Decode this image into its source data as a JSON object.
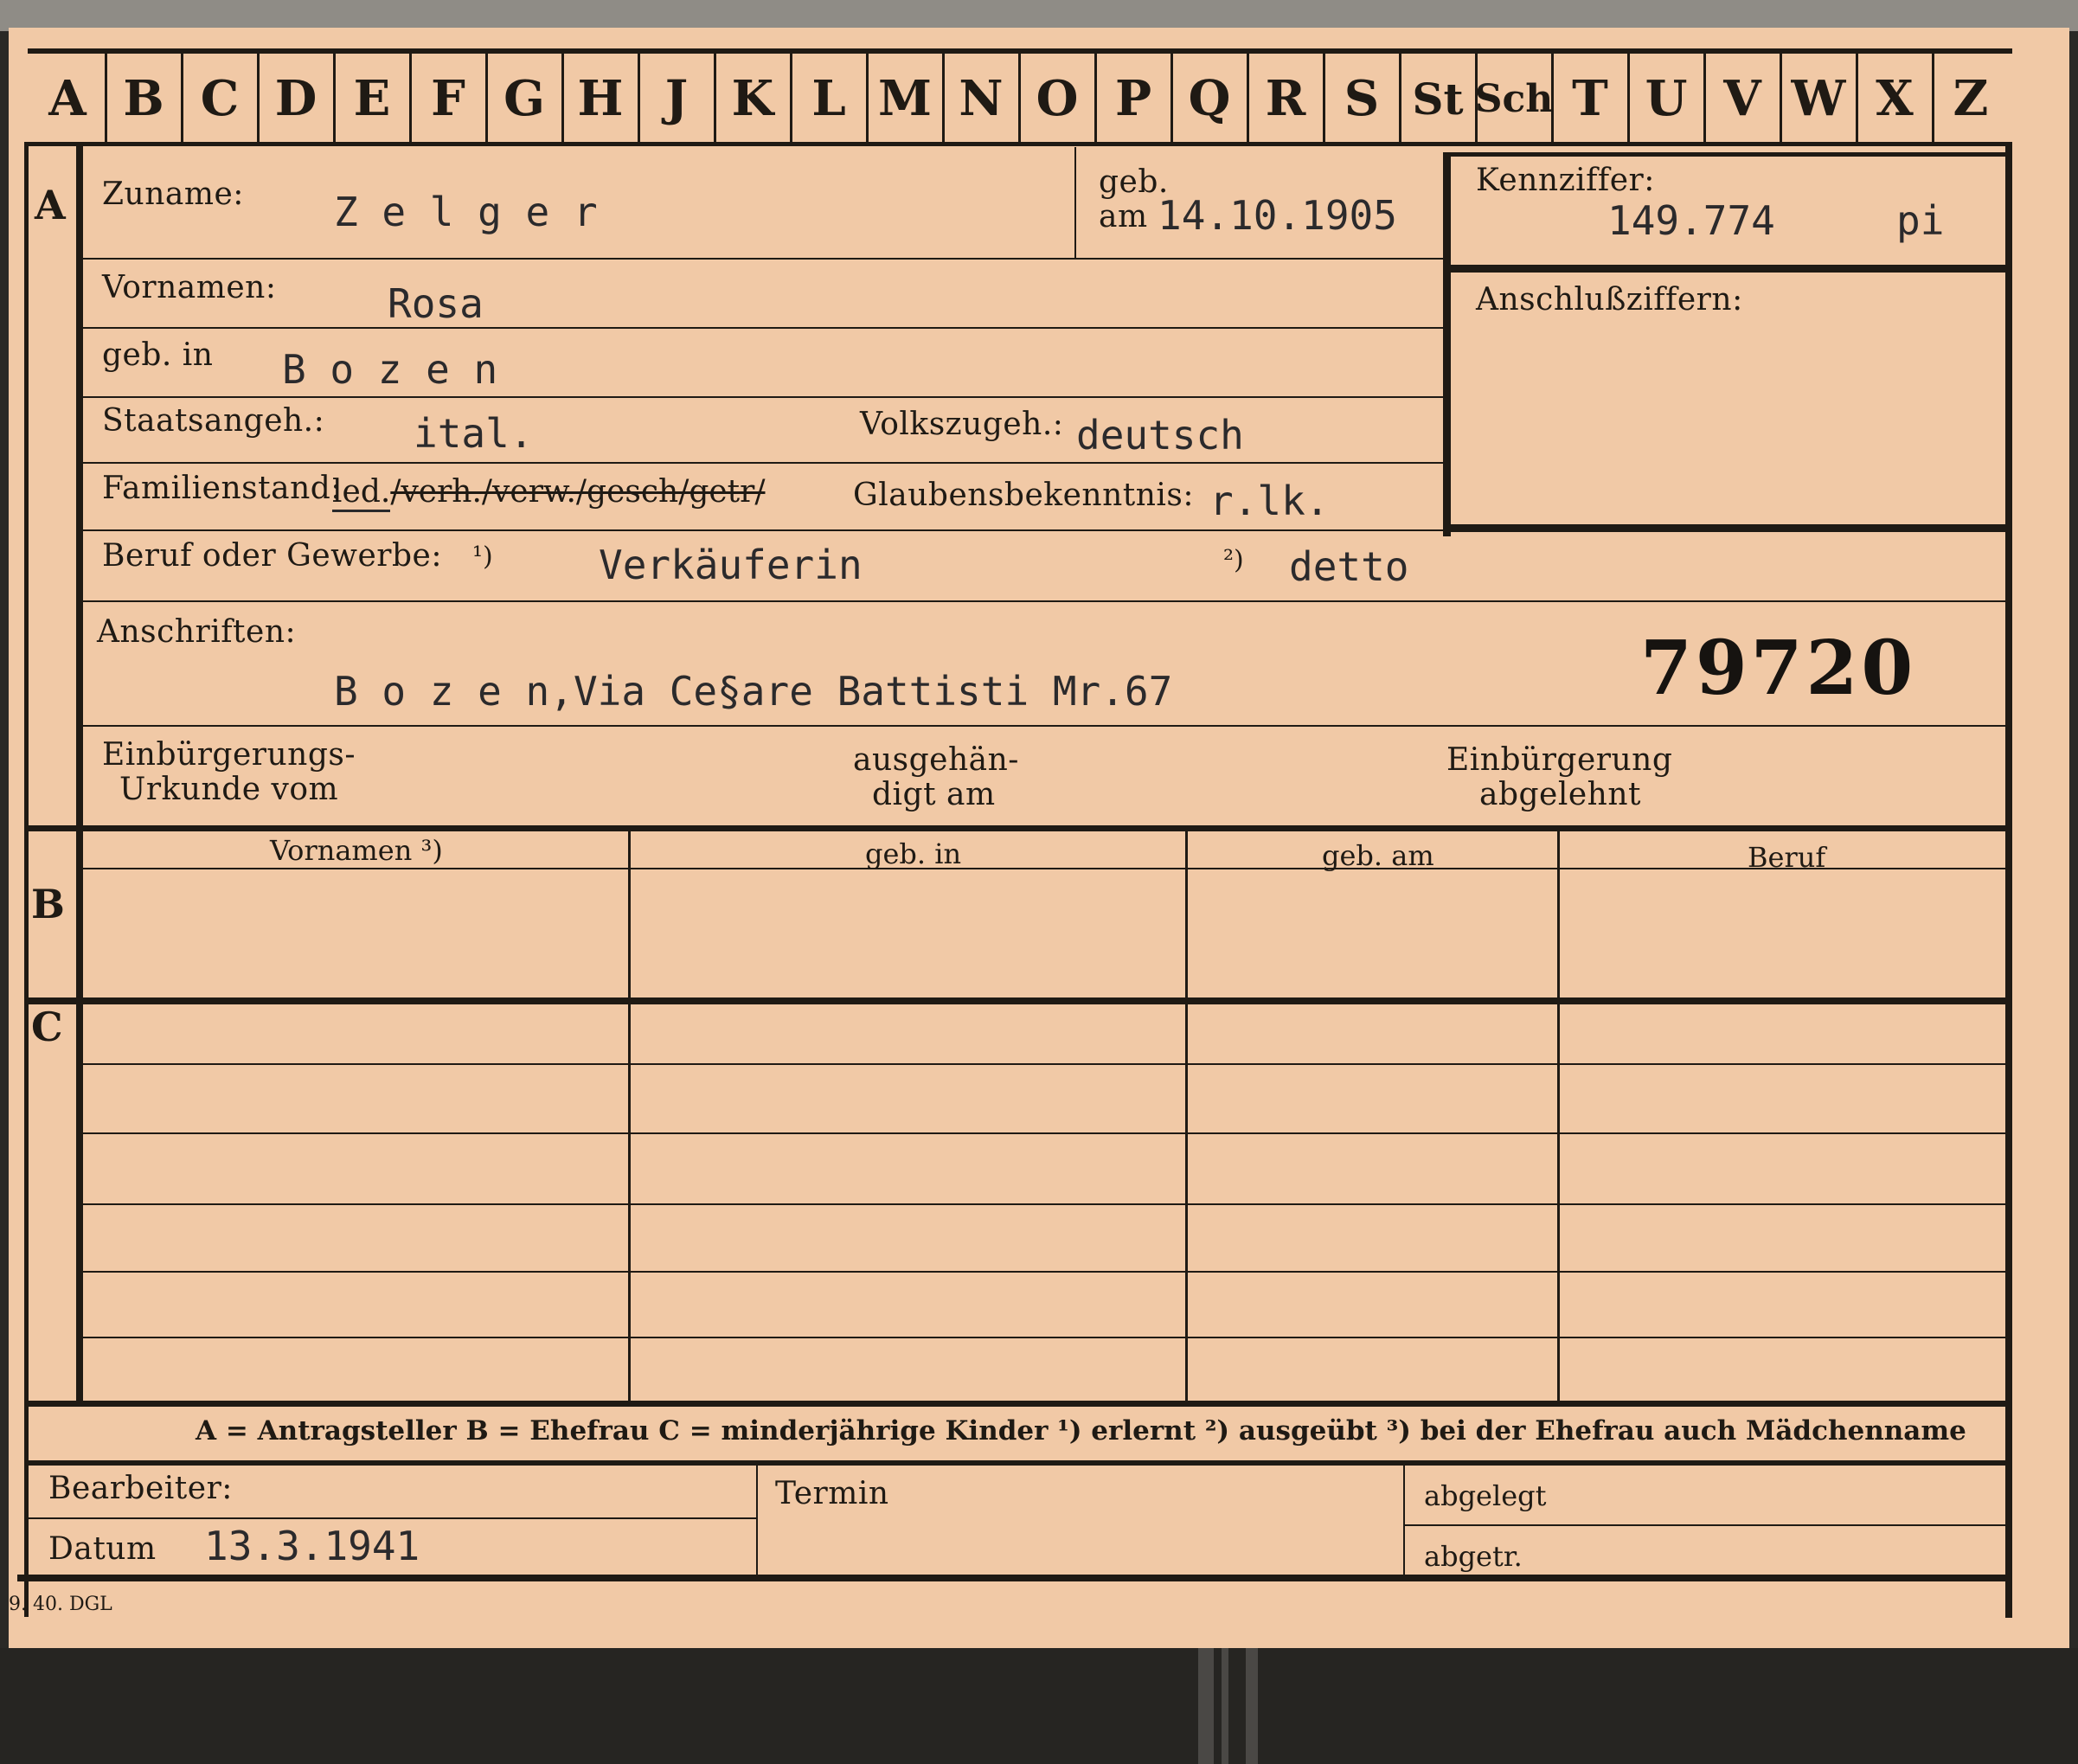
{
  "tabs": [
    "A",
    "B",
    "C",
    "D",
    "E",
    "F",
    "G",
    "H",
    "J",
    "K",
    "L",
    "M",
    "N",
    "O",
    "P",
    "Q",
    "R",
    "S",
    "St",
    "Sch",
    "T",
    "U",
    "V",
    "W",
    "X",
    "Z"
  ],
  "section_marks": {
    "a": "A",
    "b": "B",
    "c": "C"
  },
  "labels": {
    "zuname": "Zuname:",
    "geb_am_top": "geb.",
    "geb_am_bottom": "am",
    "kennziffer": "Kennziffer:",
    "vornamen": "Vornamen:",
    "anschlussziffern": "Anschlußziffern:",
    "geb_in": "geb. in",
    "staatsangeh": "Staatsangeh.:",
    "volkszugeh": "Volkszugeh.:",
    "familienstand": "Familienstand:",
    "glaubensbekenntnis": "Glaubensbekenntnis:",
    "beruf": "Beruf oder Gewerbe:",
    "beruf_note1": "¹)",
    "beruf_note2": "²)",
    "anschriften": "Anschriften:",
    "einb_urkunde_1": "Einbürgerungs-",
    "einb_urkunde_2": "Urkunde vom",
    "ausgehaendigt_1": "ausgehän-",
    "ausgehaendigt_2": "digt am",
    "einb_abgelehnt_1": "Einbürgerung",
    "einb_abgelehnt_2": "abgelehnt",
    "col_vornamen": "Vornamen ³)",
    "col_geb_in": "geb. in",
    "col_geb_am": "geb. am",
    "col_beruf": "Beruf",
    "legend": "A = Antragsteller   B = Ehefrau   C = minderjährige Kinder   ¹) erlernt   ²) ausgeübt   ³) bei der Ehefrau auch Mädchenname",
    "bearbeiter": "Bearbeiter:",
    "datum": "Datum",
    "termin": "Termin",
    "abgelegt": "abgelegt",
    "abgetr": "abgetr.",
    "imprint": "9. 40. DGL"
  },
  "values": {
    "zuname": "Z e l g e r",
    "geb_am": "14.10.1905",
    "kennziffer": "149.774",
    "kennziffer_suffix": "pi",
    "vornamen": "Rosa",
    "geb_in": "B o z e n",
    "staatsangeh": "ital.",
    "volkszugeh": "deutsch",
    "familienstand_kept": "led.",
    "familienstand_struck": "/verh./verw./gesch/getr/",
    "glaubensbekenntnis": "r.lk.",
    "beruf_erlernt": "Verkäuferin",
    "beruf_ausgeuebt": "detto",
    "anschrift": "B o z e n,Via Ce§are Battisti Mr.67",
    "number": "79720",
    "datum": "13.3.1941"
  },
  "colors": {
    "card": "#f1c9a6",
    "ink": "#1f1a14",
    "typewriter": "#2b2a2c"
  }
}
